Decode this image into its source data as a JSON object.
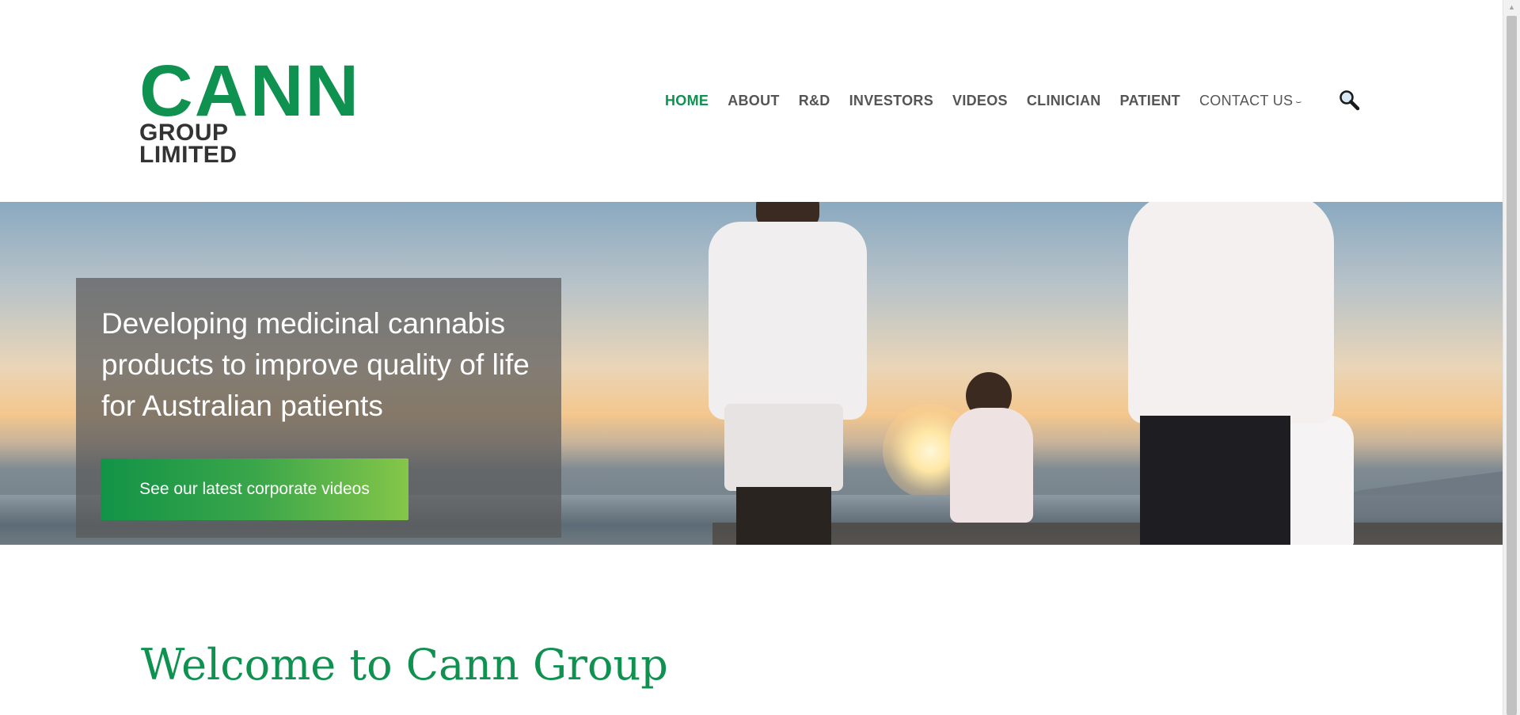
{
  "logo": {
    "main": "CANN",
    "sub": "GROUP LIMITED"
  },
  "nav": {
    "items": [
      {
        "label": "HOME",
        "active": true
      },
      {
        "label": "ABOUT"
      },
      {
        "label": "R&D"
      },
      {
        "label": "INVESTORS"
      },
      {
        "label": "VIDEOS"
      },
      {
        "label": "CLINICIAN"
      },
      {
        "label": "PATIENT"
      },
      {
        "label": "CONTACT US",
        "has_dropdown": true
      }
    ],
    "search_icon": "search-icon"
  },
  "hero": {
    "headline": "Developing medicinal cannabis products to improve quality of life for Australian patients",
    "button_label": "See our latest corporate videos"
  },
  "welcome": {
    "title": "Welcome to Cann Group"
  },
  "colors": {
    "brand_green": "#0f9150",
    "button_gradient_start": "#129347",
    "button_gradient_end": "#85c649",
    "nav_text": "#555555"
  }
}
